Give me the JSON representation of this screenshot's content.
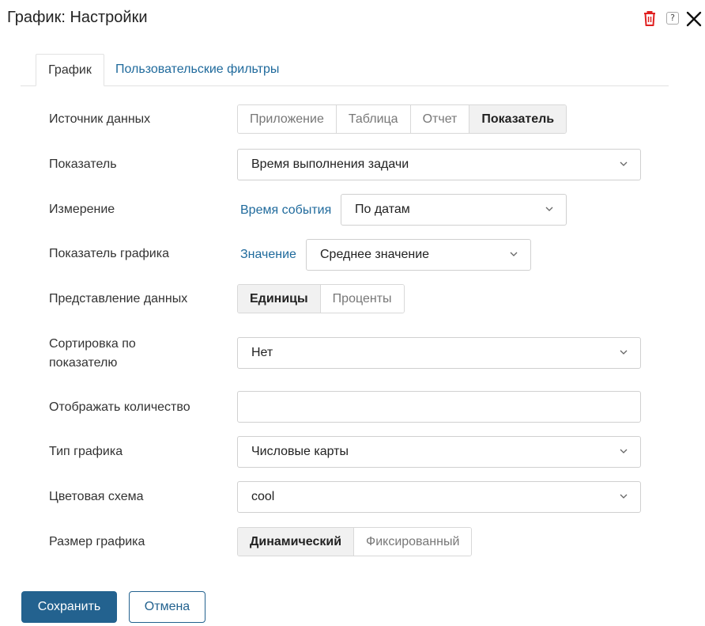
{
  "dialog": {
    "title": "График: Настройки"
  },
  "icons": {
    "delete": "trash-icon",
    "help": "help-icon",
    "close": "close-icon",
    "help_glyph": "?"
  },
  "colors": {
    "accent": "#23628f",
    "link": "#1f6a9c",
    "delete": "#e02020"
  },
  "tabs": [
    {
      "label": "График",
      "active": true
    },
    {
      "label": "Пользовательские фильтры",
      "active": false
    }
  ],
  "form": {
    "data_source": {
      "label": "Источник данных",
      "options": [
        "Приложение",
        "Таблица",
        "Отчет",
        "Показатель"
      ],
      "selected": "Показатель"
    },
    "indicator": {
      "label": "Показатель",
      "value": "Время выполнения задачи"
    },
    "dimension": {
      "label": "Измерение",
      "link": "Время события",
      "value": "По датам"
    },
    "chart_indicator": {
      "label": "Показатель графика",
      "link": "Значение",
      "value": "Среднее значение"
    },
    "data_view": {
      "label": "Представление данных",
      "options": [
        "Единицы",
        "Проценты"
      ],
      "selected": "Единицы"
    },
    "sort": {
      "label": "Сортировка по показателю",
      "value": "Нет"
    },
    "count": {
      "label": "Отображать количество",
      "value": ""
    },
    "chart_type": {
      "label": "Тип графика",
      "value": "Числовые карты"
    },
    "color_scheme": {
      "label": "Цветовая схема",
      "value": "cool"
    },
    "chart_size": {
      "label": "Размер графика",
      "options": [
        "Динамический",
        "Фиксированный"
      ],
      "selected": "Динамический"
    }
  },
  "footer": {
    "save": "Сохранить",
    "cancel": "Отмена"
  }
}
